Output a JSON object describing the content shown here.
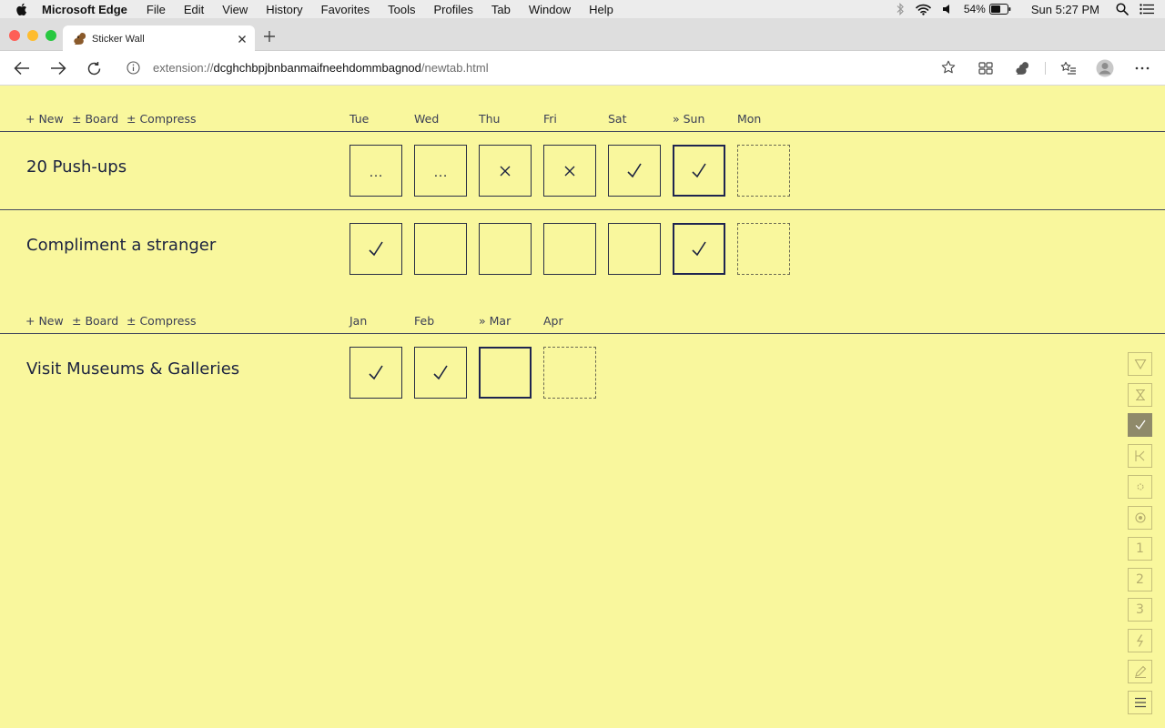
{
  "menubar": {
    "app_name": "Microsoft Edge",
    "items": [
      "File",
      "Edit",
      "View",
      "History",
      "Favorites",
      "Tools",
      "Profiles",
      "Tab",
      "Window",
      "Help"
    ],
    "battery": "54%",
    "clock": "Sun 5:27 PM"
  },
  "browser": {
    "tab_title": "Sticker Wall",
    "url_scheme": "extension://",
    "url_host": "dcghchbpjbnbanmaifneehdommbagnod",
    "url_path": "/newtab.html"
  },
  "board_controls": {
    "new": "+ New",
    "board": "± Board",
    "compress": "± Compress"
  },
  "weekly": {
    "days": [
      "Tue",
      "Wed",
      "Thu",
      "Fri",
      "Sat",
      "» Sun",
      "Mon"
    ],
    "habits": [
      {
        "name": "20 Push-ups",
        "marks": [
          "…",
          "…",
          "x",
          "x",
          "check",
          "check",
          ""
        ]
      },
      {
        "name": "Compliment a stranger",
        "marks": [
          "check",
          "",
          "",
          "",
          "",
          "check",
          ""
        ]
      }
    ]
  },
  "monthly": {
    "months": [
      "Jan",
      "Feb",
      "» Mar",
      "Apr"
    ],
    "habits": [
      {
        "name": "Visit Museums & Galleries",
        "marks": [
          "check",
          "check",
          "",
          ""
        ]
      }
    ]
  },
  "tools": [
    {
      "icon": "triangle-down-icon",
      "label": ""
    },
    {
      "icon": "hourglass-icon",
      "label": ""
    },
    {
      "icon": "check-icon",
      "label": "",
      "active": true
    },
    {
      "icon": "branch-icon",
      "label": ""
    },
    {
      "icon": "dot-circle-icon",
      "label": ""
    },
    {
      "icon": "target-icon",
      "label": ""
    },
    {
      "icon": "number-one-icon",
      "label": "1"
    },
    {
      "icon": "number-two-icon",
      "label": "2"
    },
    {
      "icon": "number-three-icon",
      "label": "3"
    },
    {
      "icon": "lightning-icon",
      "label": ""
    },
    {
      "icon": "pencil-icon",
      "label": ""
    },
    {
      "icon": "menu-icon",
      "label": ""
    }
  ],
  "colors": {
    "page_background": "#f9f79d",
    "ink": "#1c2340",
    "active_tool": "#8f8a6a"
  }
}
